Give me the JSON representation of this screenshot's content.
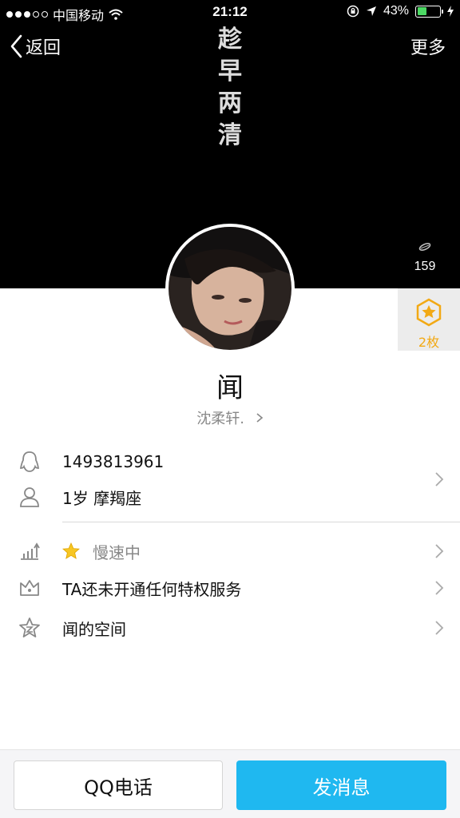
{
  "status_bar": {
    "carrier": "中国移动",
    "time": "21:12",
    "battery_percent": "43%",
    "battery_level": 0.43
  },
  "nav": {
    "back_label": "返回",
    "more_label": "更多"
  },
  "cover": {
    "calligraphy": [
      "趁",
      "早",
      "两",
      "清"
    ],
    "like_count": "159"
  },
  "medal": {
    "label": "2枚"
  },
  "profile": {
    "name": "闻",
    "remark": "沈柔轩."
  },
  "info": {
    "qq_number": "1493813961",
    "age_sign": "1岁 摩羯座"
  },
  "list": {
    "level_text": "慢速中",
    "privilege_text": "TA还未开通任何特权服务",
    "space_text": "闻的空间"
  },
  "actions": {
    "call_label": "QQ电话",
    "message_label": "发消息"
  },
  "colors": {
    "accent": "#1fb8f0",
    "medal": "#f2a915",
    "battery": "#4cd964"
  }
}
